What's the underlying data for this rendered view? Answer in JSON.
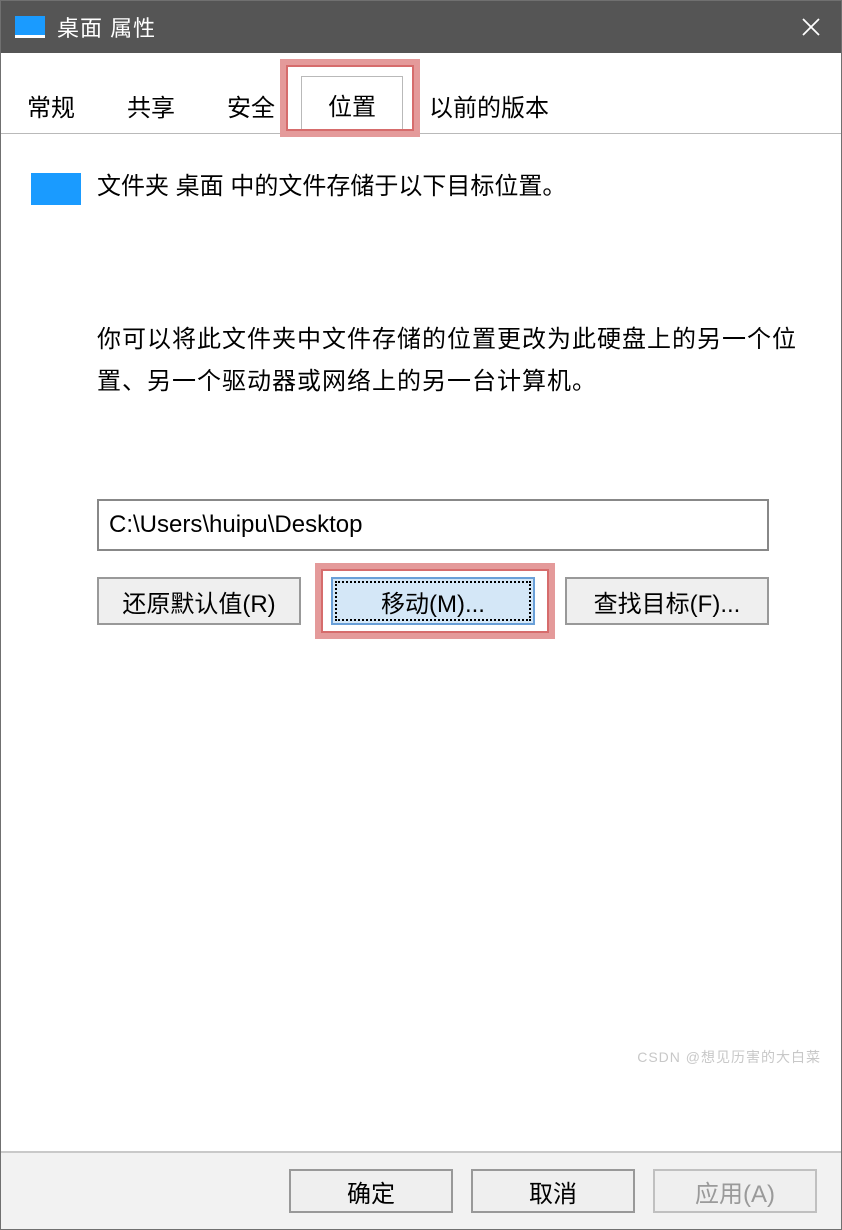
{
  "title": "桌面 属性",
  "tabs": {
    "general": "常规",
    "share": "共享",
    "security": "安全",
    "location": "位置",
    "previous": "以前的版本"
  },
  "content": {
    "intro": "文件夹 桌面 中的文件存储于以下目标位置。",
    "explain": "你可以将此文件夹中文件存储的位置更改为此硬盘上的另一个位置、另一个驱动器或网络上的另一台计算机。",
    "path": "C:\\Users\\huipu\\Desktop"
  },
  "buttons": {
    "restore": "还原默认值(R)",
    "move": "移动(M)...",
    "find": "查找目标(F)..."
  },
  "footer": {
    "ok": "确定",
    "cancel": "取消",
    "apply": "应用(A)"
  },
  "watermark": "CSDN @想见历害的大白菜"
}
